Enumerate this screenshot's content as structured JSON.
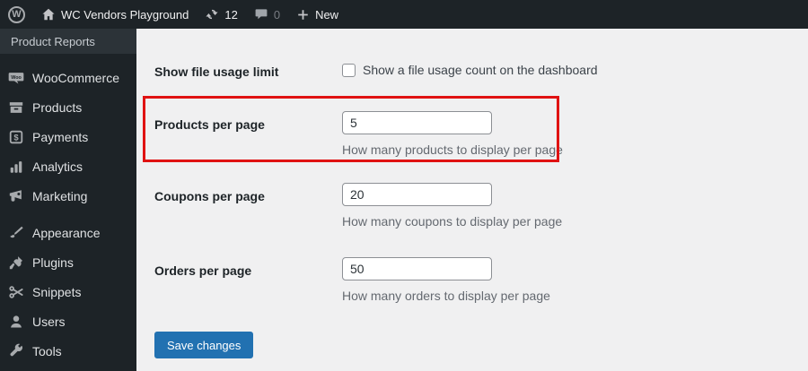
{
  "admin_bar": {
    "wp_logo_letter": "W",
    "site_name": "WC Vendors Playground",
    "updates_count": "12",
    "comments_count": "0",
    "new_label": "New"
  },
  "sidebar": {
    "submenu_current": "Product Reports",
    "woo_badge": "Woo",
    "payments_symbol": "$",
    "items": [
      {
        "label": "WooCommerce"
      },
      {
        "label": "Products"
      },
      {
        "label": "Payments"
      },
      {
        "label": "Analytics"
      },
      {
        "label": "Marketing"
      },
      {
        "label": "Appearance"
      },
      {
        "label": "Plugins"
      },
      {
        "label": "Snippets"
      },
      {
        "label": "Users"
      },
      {
        "label": "Tools"
      }
    ]
  },
  "form": {
    "checkbox_row": {
      "label": "Show file usage limit",
      "checkbox_label": "Show a file usage count on the dashboard",
      "checked": false
    },
    "rows": [
      {
        "label": "Products per page",
        "value": "5",
        "help": "How many products to display per page",
        "highlighted": true
      },
      {
        "label": "Coupons per page",
        "value": "20",
        "help": "How many coupons to display per page",
        "highlighted": false
      },
      {
        "label": "Orders per page",
        "value": "50",
        "help": "How many orders to display per page",
        "highlighted": false
      }
    ],
    "save_label": "Save changes"
  },
  "colors": {
    "admin_bar_bg": "#1d2327",
    "sidebar_bg": "#1d2327",
    "submenu_bg": "#2c3338",
    "content_bg": "#f0f0f1",
    "accent_blue": "#2271b1",
    "highlight_red": "#e01212",
    "input_border": "#8c8f94",
    "help_text": "#646970",
    "icon_gray": "#a7aaad"
  }
}
